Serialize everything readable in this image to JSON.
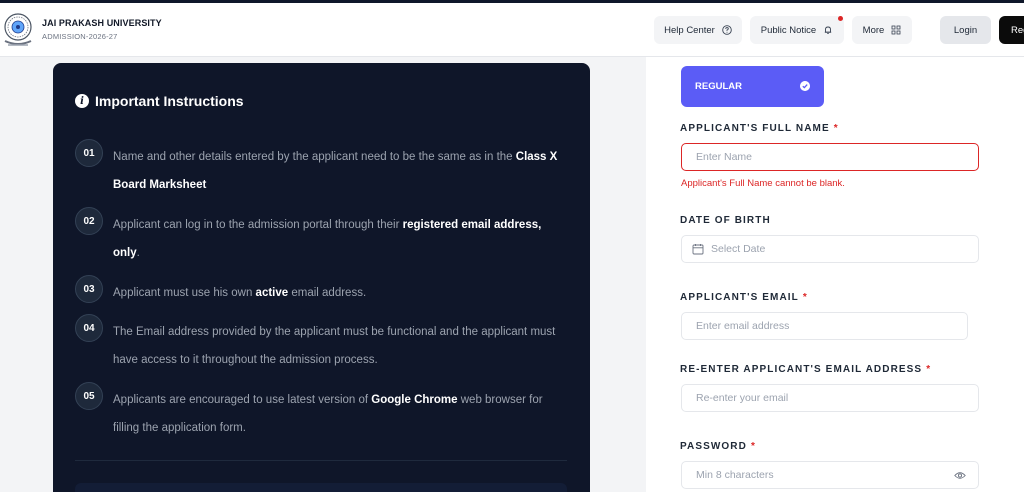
{
  "header": {
    "university_name": "JAI PRAKASH UNIVERSITY",
    "subtitle": "ADMISSION-2026-27",
    "help_center": "Help Center",
    "public_notice": "Public Notice",
    "more": "More",
    "login": "Login",
    "register": "Reg"
  },
  "instructions": {
    "title": "Important Instructions",
    "items": [
      {
        "num": "01",
        "parts": [
          {
            "t": "Name and other details entered by the applicant need to be the same as in the ",
            "b": false
          },
          {
            "t": "Class X Board Marksheet",
            "b": true
          }
        ]
      },
      {
        "num": "02",
        "parts": [
          {
            "t": "Applicant can log in to the admission portal through their ",
            "b": false
          },
          {
            "t": "registered email address, only",
            "b": true
          },
          {
            "t": ".",
            "b": false
          }
        ]
      },
      {
        "num": "03",
        "parts": [
          {
            "t": "Applicant must use his own ",
            "b": false
          },
          {
            "t": "active",
            "b": true
          },
          {
            "t": " email address.",
            "b": false
          }
        ]
      },
      {
        "num": "04",
        "parts": [
          {
            "t": "The Email address provided by the applicant must be functional and the applicant must have access to it throughout the admission process.",
            "b": false
          }
        ]
      },
      {
        "num": "05",
        "parts": [
          {
            "t": "Applicants are encouraged to use latest version of ",
            "b": false
          },
          {
            "t": "Google Chrome",
            "b": true
          },
          {
            "t": " web browser for filling the application form.",
            "b": false
          }
        ]
      }
    ]
  },
  "form": {
    "category": "REGULAR",
    "full_name_label": "APPLICANT'S FULL NAME",
    "full_name_placeholder": "Enter Name",
    "full_name_error": "Applicant's Full Name cannot be blank.",
    "dob_label": "DATE OF BIRTH",
    "dob_placeholder": "Select Date",
    "email_label": "APPLICANT'S EMAIL",
    "email_placeholder": "Enter email address",
    "reemail_label": "RE-ENTER APPLICANT'S EMAIL ADDRESS",
    "reemail_placeholder": "Re-enter your email",
    "password_label": "PASSWORD",
    "password_placeholder": "Min 8 characters",
    "required_mark": "*"
  },
  "colors": {
    "accent": "#5b5cf6",
    "error": "#dc2626",
    "panel": "#0f1629"
  }
}
